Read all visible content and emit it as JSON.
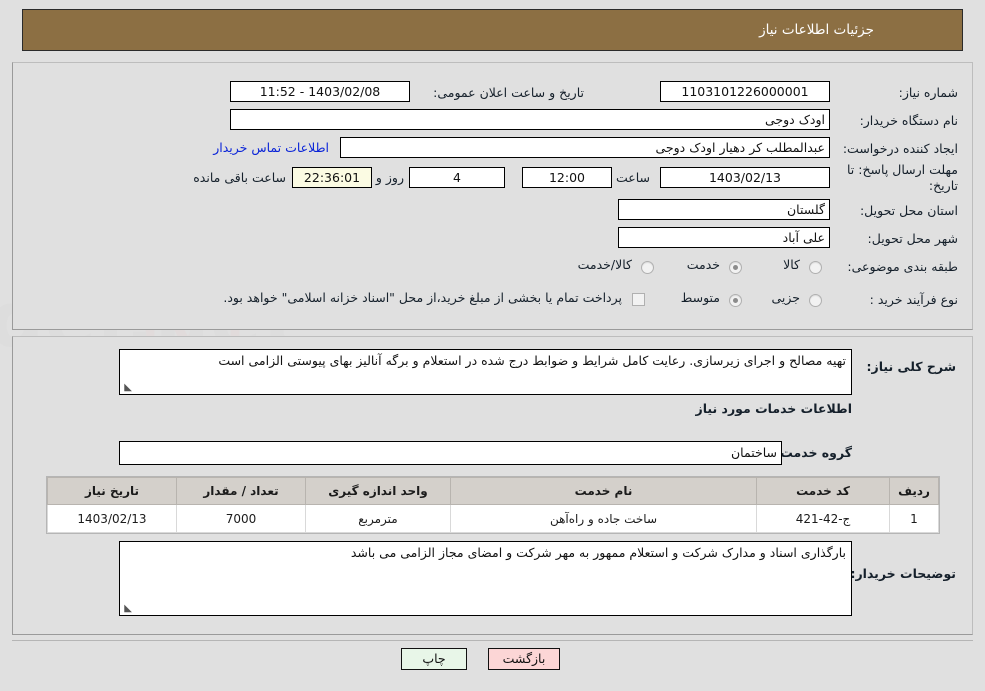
{
  "header": {
    "title": "جزئیات اطلاعات نیاز"
  },
  "top_panel": {
    "need_number_label": "شماره نیاز:",
    "need_number_value": "1103101226000001",
    "announce_datetime_label": "تاریخ و ساعت اعلان عمومی:",
    "announce_datetime_value": "1403/02/08 - 11:52",
    "buyer_org_label": "نام دستگاه خریدار:",
    "buyer_org_value": "اودک دوجی",
    "request_creator_label": "ایجاد کننده درخواست:",
    "request_creator_value": "عبدالمطلب کر دهیار اودک دوجی",
    "buyer_contact_link": "اطلاعات تماس خریدار",
    "deadline_label_line1": "مهلت ارسال پاسخ: تا",
    "deadline_label_line2": "تاریخ:",
    "deadline_date_value": "1403/02/13",
    "deadline_hour_label": "ساعت",
    "deadline_hour_value": "12:00",
    "remaining_days_value": "4",
    "remaining_days_label": "روز و",
    "remaining_time_value": "22:36:01",
    "remaining_time_label": "ساعت باقی مانده",
    "province_label": "استان محل تحویل:",
    "province_value": "گلستان",
    "city_label": "شهر محل تحویل:",
    "city_value": "علی آباد",
    "category_label": "طبقه بندی موضوعی:",
    "category_options": [
      {
        "label": "کالا",
        "selected": false
      },
      {
        "label": "خدمت",
        "selected": true
      },
      {
        "label": "کالا/خدمت",
        "selected": false
      }
    ],
    "process_type_label": "نوع فرآیند خرید :",
    "process_type_options": [
      {
        "label": "جزیی",
        "selected": false
      },
      {
        "label": "متوسط",
        "selected": true
      }
    ],
    "treasury_note": "پرداخت تمام یا بخشی از مبلغ خرید،از محل \"اسناد خزانه اسلامی\" خواهد بود."
  },
  "mid_panel": {
    "general_desc_label": "شرح کلی نیاز:",
    "general_desc_value": "تهیه مصالح و اجرای زیرسازی. رعایت کامل شرایط و ضوابط درج شده در استعلام و برگه آنالیز  بهای پیوستی الزامی است",
    "services_section_title": "اطلاعات خدمات مورد نیاز",
    "service_group_label": "گروه خدمت:",
    "service_group_value": "ساختمان",
    "buyer_notes_label": "توضیحات خریدار:",
    "buyer_notes_value": "بارگذاری اسناد و مدارک شرکت و استعلام ممهور به مهر شرکت و امضای مجاز الزامی می باشد"
  },
  "table": {
    "columns": [
      "ردیف",
      "کد خدمت",
      "نام خدمت",
      "واحد اندازه گیری",
      "تعداد / مقدار",
      "تاریخ نیاز"
    ],
    "rows": [
      {
        "row_no": "1",
        "service_code": "ج-42-421",
        "service_name": "ساخت جاده و راه‌آهن",
        "unit": "مترمربع",
        "quantity": "7000",
        "need_date": "1403/02/13"
      }
    ]
  },
  "footer": {
    "print_label": "چاپ",
    "back_label": "بازگشت"
  },
  "watermark": {
    "text": "AriaTender.net"
  },
  "colors": {
    "header_brown": "#8c6f43",
    "page_bg": "#e0e0e0",
    "link_blue": "#0a24d8",
    "print_btn_bg": "#e8f6e8",
    "back_btn_bg": "#fcd6d6",
    "highlight_field_bg": "#fbfbe3",
    "table_header_bg": "#d4d0cb"
  }
}
